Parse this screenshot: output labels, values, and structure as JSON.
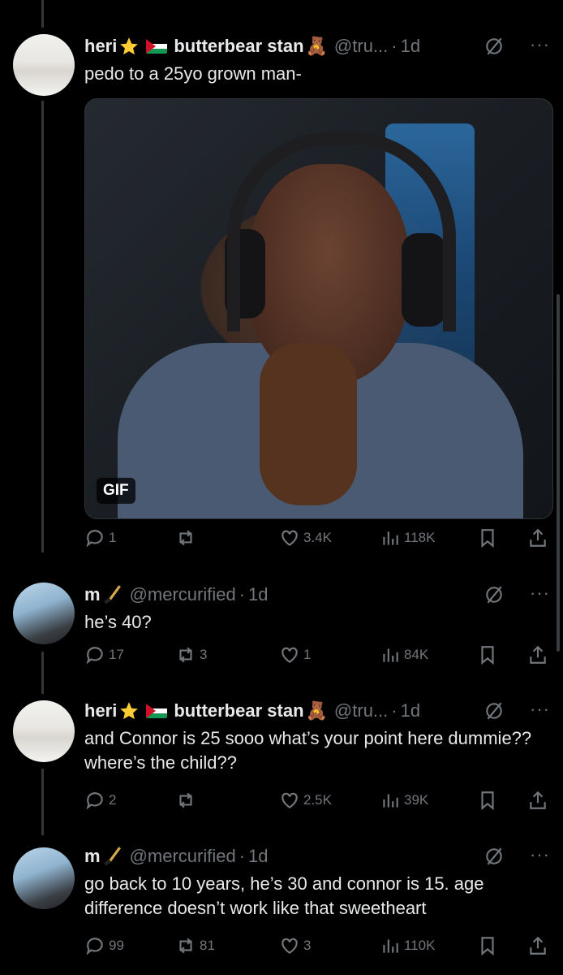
{
  "tweets": [
    {
      "name": "heri",
      "name2": "butterbear stan",
      "handle": "@tru...",
      "dot": "·",
      "time": "1d",
      "text": "pedo to a 25yo grown man-",
      "has_gif": true,
      "gif_label": "GIF",
      "stats": {
        "replies": "1",
        "retweets": "",
        "likes": "3.4K",
        "views": "118K"
      }
    },
    {
      "name": "m",
      "name2": "",
      "handle": "@mercurified",
      "dot": "·",
      "time": "1d",
      "text": "he’s 40?",
      "stats": {
        "replies": "17",
        "retweets": "3",
        "likes": "1",
        "views": "84K"
      }
    },
    {
      "name": "heri",
      "name2": "butterbear stan",
      "handle": "@tru...",
      "dot": "·",
      "time": "1d",
      "text": "and Connor is 25 sooo what’s your point here dummie?? where’s the child??",
      "stats": {
        "replies": "2",
        "retweets": "",
        "likes": "2.5K",
        "views": "39K"
      }
    },
    {
      "name": "m",
      "name2": "",
      "handle": "@mercurified",
      "dot": "·",
      "time": "1d",
      "text": "go back to 10 years, he’s 30 and connor is 15. age difference doesn’t work like that sweetheart",
      "stats": {
        "replies": "99",
        "retweets": "81",
        "likes": "3",
        "views": "110K"
      }
    }
  ],
  "icons": {
    "star": "star-emoji",
    "flag": "palestine-flag-emoji",
    "bear": "teddy-bear-emoji",
    "hockey": "hockey-stick-emoji",
    "grok": "grok-icon",
    "more": "more-icon",
    "reply": "reply-icon",
    "retweet": "retweet-icon",
    "like": "heart-icon",
    "views": "views-icon",
    "bookmark": "bookmark-icon",
    "share": "share-icon"
  },
  "emoji": {
    "bear": "🧸"
  },
  "more_glyph": "···",
  "colors": {
    "background": "#000000",
    "text": "#e7e9ea",
    "muted": "#71767b",
    "thread": "#333639"
  }
}
